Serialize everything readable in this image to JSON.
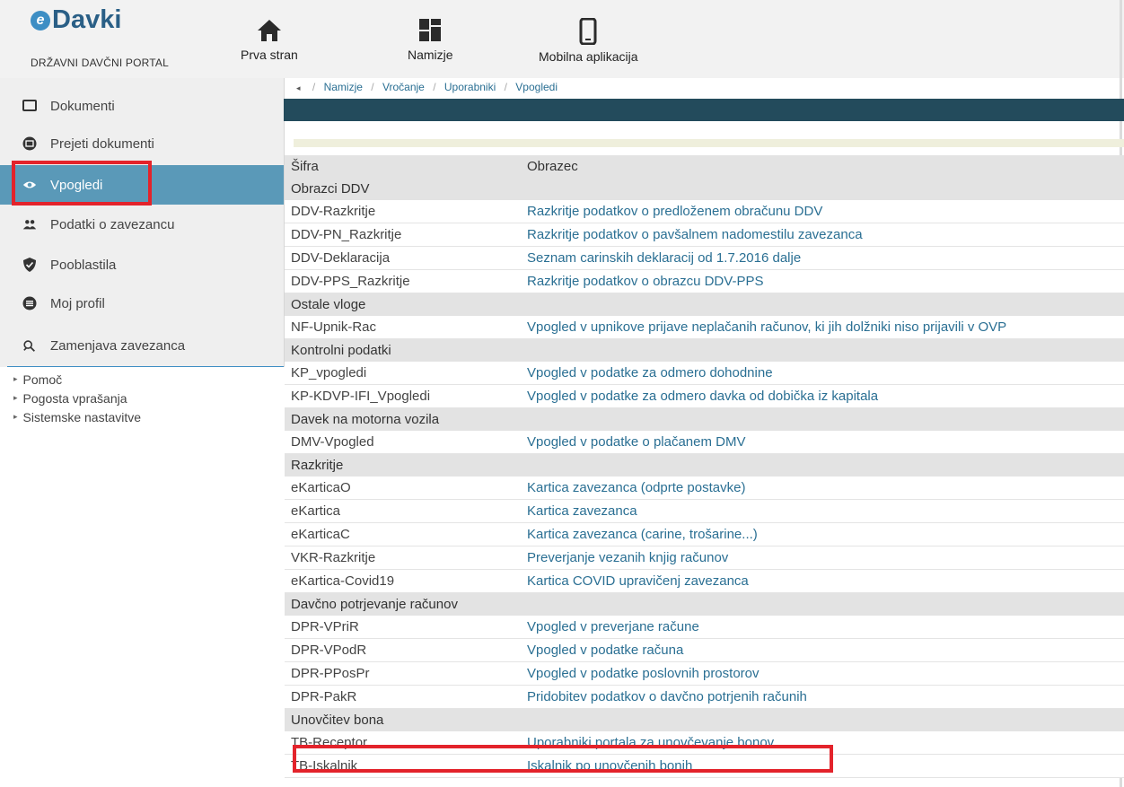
{
  "header": {
    "brand": "Davki",
    "brand_sub": "DRŽAVNI DAVČNI PORTAL",
    "nav": [
      {
        "label": "Prva stran",
        "icon": "home-icon"
      },
      {
        "label": "Namizje",
        "icon": "dashboard-icon"
      },
      {
        "label": "Mobilna aplikacija",
        "icon": "mobile-icon"
      }
    ]
  },
  "sidebar": {
    "items": [
      {
        "label": "Dokumenti",
        "icon": "document-icon"
      },
      {
        "label": "Prejeti dokumenti",
        "icon": "inbox-icon"
      },
      {
        "label": "Vpogledi",
        "icon": "eye-icon"
      },
      {
        "label": "Podatki o zavezancu",
        "icon": "users-icon"
      },
      {
        "label": "Pooblastila",
        "icon": "shield-icon"
      },
      {
        "label": "Moj profil",
        "icon": "profile-icon"
      },
      {
        "label": "Zamenjava zavezanca",
        "icon": "switch-user-icon"
      }
    ],
    "links": [
      {
        "label": "Pomoč"
      },
      {
        "label": "Pogosta vprašanja"
      },
      {
        "label": "Sistemske nastavitve"
      }
    ]
  },
  "breadcrumb": [
    "Namizje",
    "Vročanje",
    "Uporabniki",
    "Vpogledi"
  ],
  "table": {
    "headers": [
      "Šifra",
      "Obrazec"
    ],
    "rows": [
      {
        "type": "group",
        "code": "Obrazci DDV",
        "form": ""
      },
      {
        "type": "row",
        "code": "DDV-Razkritje",
        "form": "Razkritje podatkov o predloženem obračunu DDV"
      },
      {
        "type": "row",
        "code": "DDV-PN_Razkritje",
        "form": "Razkritje podatkov o pavšalnem nadomestilu zavezanca"
      },
      {
        "type": "row",
        "code": "DDV-Deklaracija",
        "form": "Seznam carinskih deklaracij od 1.7.2016 dalje"
      },
      {
        "type": "row",
        "code": "DDV-PPS_Razkritje",
        "form": "Razkritje podatkov o obrazcu DDV-PPS"
      },
      {
        "type": "group",
        "code": "Ostale vloge",
        "form": ""
      },
      {
        "type": "row",
        "code": "NF-Upnik-Rac",
        "form": "Vpogled v upnikove prijave neplačanih računov, ki jih dolžniki niso prijavili v OVP"
      },
      {
        "type": "group",
        "code": "Kontrolni podatki",
        "form": ""
      },
      {
        "type": "row",
        "code": "KP_vpogledi",
        "form": "Vpogled v podatke za odmero dohodnine"
      },
      {
        "type": "row",
        "code": "KP-KDVP-IFI_Vpogledi",
        "form": "Vpogled v podatke za odmero davka od dobička iz kapitala"
      },
      {
        "type": "group",
        "code": "Davek na motorna vozila",
        "form": ""
      },
      {
        "type": "row",
        "code": "DMV-Vpogled",
        "form": "Vpogled v podatke o plačanem DMV"
      },
      {
        "type": "group",
        "code": "Razkritje",
        "form": ""
      },
      {
        "type": "row",
        "code": "eKarticaO",
        "form": "Kartica zavezanca (odprte postavke)"
      },
      {
        "type": "row",
        "code": "eKartica",
        "form": "Kartica zavezanca"
      },
      {
        "type": "row",
        "code": "eKarticaC",
        "form": "Kartica zavezanca (carine, trošarine...)"
      },
      {
        "type": "row",
        "code": "VKR-Razkritje",
        "form": "Preverjanje vezanih knjig računov"
      },
      {
        "type": "row",
        "code": "eKartica-Covid19",
        "form": "Kartica COVID upravičenj zavezanca"
      },
      {
        "type": "group",
        "code": "Davčno potrjevanje računov",
        "form": ""
      },
      {
        "type": "row",
        "code": "DPR-VPriR",
        "form": "Vpogled v preverjane račune"
      },
      {
        "type": "row",
        "code": "DPR-VPodR",
        "form": "Vpogled v podatke računa"
      },
      {
        "type": "row",
        "code": "DPR-PPosPr",
        "form": "Vpogled v podatke poslovnih prostorov"
      },
      {
        "type": "row",
        "code": "DPR-PakR",
        "form": "Pridobitev podatkov o davčno potrjenih računih"
      },
      {
        "type": "group",
        "code": "Unovčitev bona",
        "form": ""
      },
      {
        "type": "row",
        "code": "TB-Receptor",
        "form": "Uporabniki portala za unovčevanje bonov"
      },
      {
        "type": "row",
        "code": "TB-Iskalnik",
        "form": "Iskalnik po unovčenih bonih"
      }
    ]
  },
  "colors": {
    "accent": "#5a99b8",
    "dark_bar": "#234b5c",
    "link": "#2a6f93",
    "highlight": "#e3232b"
  }
}
